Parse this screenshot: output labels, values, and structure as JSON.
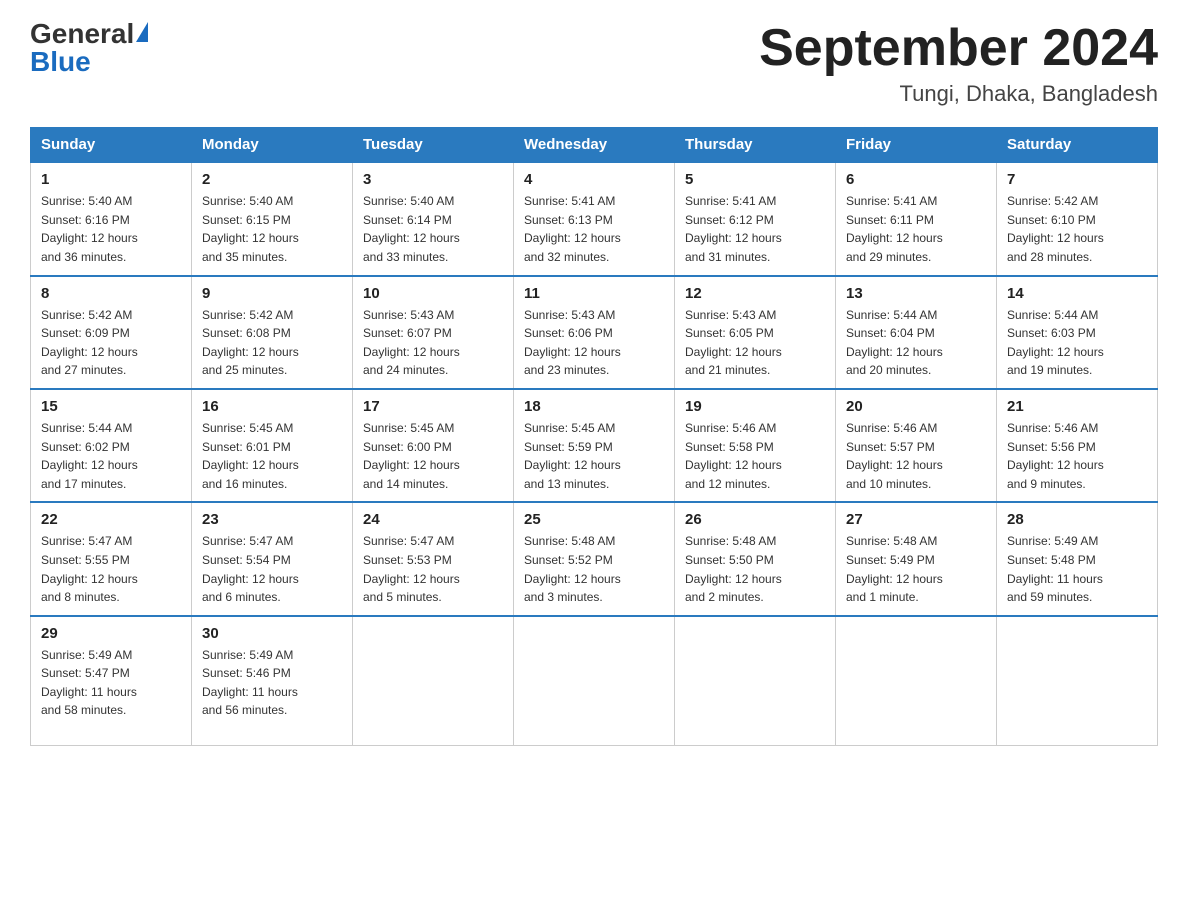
{
  "header": {
    "logo_general": "General",
    "logo_blue": "Blue",
    "month_title": "September 2024",
    "location": "Tungi, Dhaka, Bangladesh"
  },
  "days_of_week": [
    "Sunday",
    "Monday",
    "Tuesday",
    "Wednesday",
    "Thursday",
    "Friday",
    "Saturday"
  ],
  "weeks": [
    [
      {
        "day": "1",
        "sunrise": "5:40 AM",
        "sunset": "6:16 PM",
        "daylight": "12 hours and 36 minutes."
      },
      {
        "day": "2",
        "sunrise": "5:40 AM",
        "sunset": "6:15 PM",
        "daylight": "12 hours and 35 minutes."
      },
      {
        "day": "3",
        "sunrise": "5:40 AM",
        "sunset": "6:14 PM",
        "daylight": "12 hours and 33 minutes."
      },
      {
        "day": "4",
        "sunrise": "5:41 AM",
        "sunset": "6:13 PM",
        "daylight": "12 hours and 32 minutes."
      },
      {
        "day": "5",
        "sunrise": "5:41 AM",
        "sunset": "6:12 PM",
        "daylight": "12 hours and 31 minutes."
      },
      {
        "day": "6",
        "sunrise": "5:41 AM",
        "sunset": "6:11 PM",
        "daylight": "12 hours and 29 minutes."
      },
      {
        "day": "7",
        "sunrise": "5:42 AM",
        "sunset": "6:10 PM",
        "daylight": "12 hours and 28 minutes."
      }
    ],
    [
      {
        "day": "8",
        "sunrise": "5:42 AM",
        "sunset": "6:09 PM",
        "daylight": "12 hours and 27 minutes."
      },
      {
        "day": "9",
        "sunrise": "5:42 AM",
        "sunset": "6:08 PM",
        "daylight": "12 hours and 25 minutes."
      },
      {
        "day": "10",
        "sunrise": "5:43 AM",
        "sunset": "6:07 PM",
        "daylight": "12 hours and 24 minutes."
      },
      {
        "day": "11",
        "sunrise": "5:43 AM",
        "sunset": "6:06 PM",
        "daylight": "12 hours and 23 minutes."
      },
      {
        "day": "12",
        "sunrise": "5:43 AM",
        "sunset": "6:05 PM",
        "daylight": "12 hours and 21 minutes."
      },
      {
        "day": "13",
        "sunrise": "5:44 AM",
        "sunset": "6:04 PM",
        "daylight": "12 hours and 20 minutes."
      },
      {
        "day": "14",
        "sunrise": "5:44 AM",
        "sunset": "6:03 PM",
        "daylight": "12 hours and 19 minutes."
      }
    ],
    [
      {
        "day": "15",
        "sunrise": "5:44 AM",
        "sunset": "6:02 PM",
        "daylight": "12 hours and 17 minutes."
      },
      {
        "day": "16",
        "sunrise": "5:45 AM",
        "sunset": "6:01 PM",
        "daylight": "12 hours and 16 minutes."
      },
      {
        "day": "17",
        "sunrise": "5:45 AM",
        "sunset": "6:00 PM",
        "daylight": "12 hours and 14 minutes."
      },
      {
        "day": "18",
        "sunrise": "5:45 AM",
        "sunset": "5:59 PM",
        "daylight": "12 hours and 13 minutes."
      },
      {
        "day": "19",
        "sunrise": "5:46 AM",
        "sunset": "5:58 PM",
        "daylight": "12 hours and 12 minutes."
      },
      {
        "day": "20",
        "sunrise": "5:46 AM",
        "sunset": "5:57 PM",
        "daylight": "12 hours and 10 minutes."
      },
      {
        "day": "21",
        "sunrise": "5:46 AM",
        "sunset": "5:56 PM",
        "daylight": "12 hours and 9 minutes."
      }
    ],
    [
      {
        "day": "22",
        "sunrise": "5:47 AM",
        "sunset": "5:55 PM",
        "daylight": "12 hours and 8 minutes."
      },
      {
        "day": "23",
        "sunrise": "5:47 AM",
        "sunset": "5:54 PM",
        "daylight": "12 hours and 6 minutes."
      },
      {
        "day": "24",
        "sunrise": "5:47 AM",
        "sunset": "5:53 PM",
        "daylight": "12 hours and 5 minutes."
      },
      {
        "day": "25",
        "sunrise": "5:48 AM",
        "sunset": "5:52 PM",
        "daylight": "12 hours and 3 minutes."
      },
      {
        "day": "26",
        "sunrise": "5:48 AM",
        "sunset": "5:50 PM",
        "daylight": "12 hours and 2 minutes."
      },
      {
        "day": "27",
        "sunrise": "5:48 AM",
        "sunset": "5:49 PM",
        "daylight": "12 hours and 1 minute."
      },
      {
        "day": "28",
        "sunrise": "5:49 AM",
        "sunset": "5:48 PM",
        "daylight": "11 hours and 59 minutes."
      }
    ],
    [
      {
        "day": "29",
        "sunrise": "5:49 AM",
        "sunset": "5:47 PM",
        "daylight": "11 hours and 58 minutes."
      },
      {
        "day": "30",
        "sunrise": "5:49 AM",
        "sunset": "5:46 PM",
        "daylight": "11 hours and 56 minutes."
      },
      null,
      null,
      null,
      null,
      null
    ]
  ],
  "labels": {
    "sunrise": "Sunrise:",
    "sunset": "Sunset:",
    "daylight": "Daylight:"
  }
}
